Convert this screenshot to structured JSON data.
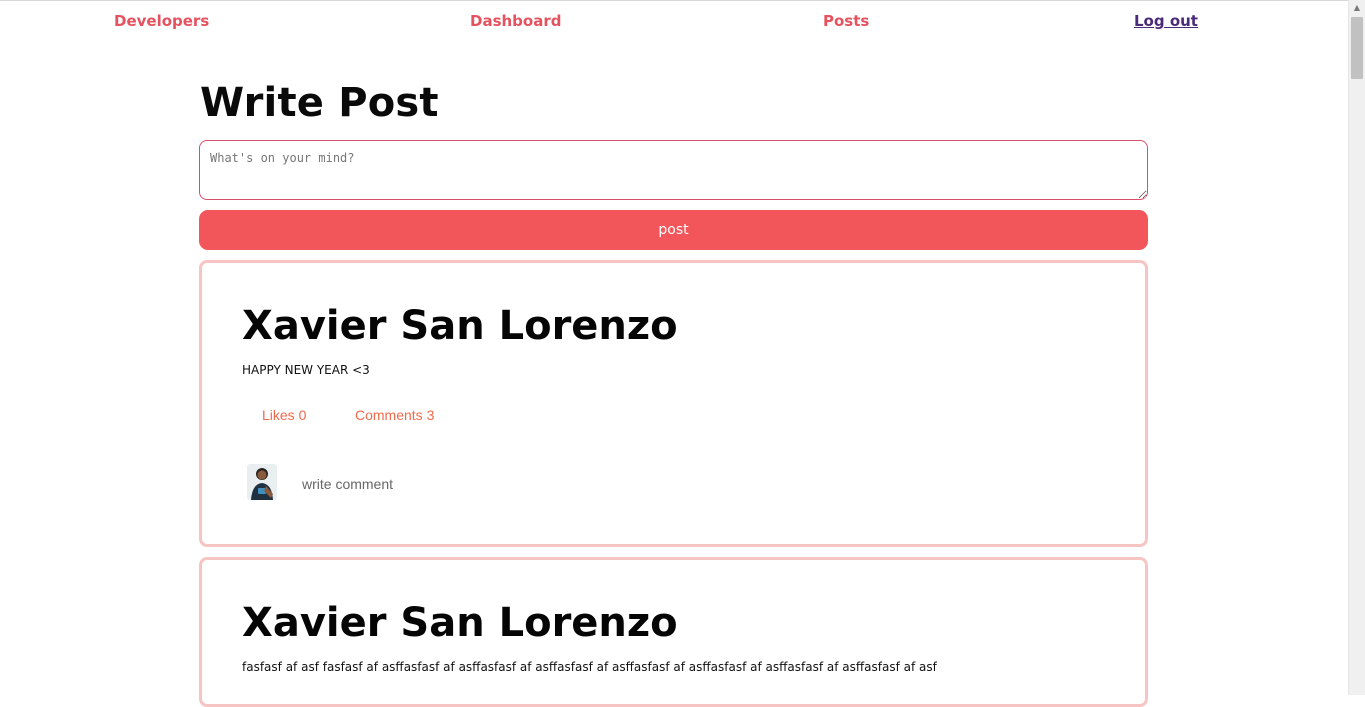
{
  "nav": {
    "developers": "Developers",
    "dashboard": "Dashboard",
    "posts": "Posts",
    "logout": "Log out"
  },
  "page": {
    "title": "Write Post"
  },
  "compose": {
    "placeholder": "What's on your mind?",
    "value": "",
    "submit_label": "post"
  },
  "posts": [
    {
      "author": "Xavier San Lorenzo",
      "text": "HAPPY NEW YEAR <3",
      "likes_label": "Likes 0",
      "comments_label": "Comments 3",
      "comment_placeholder": "write comment",
      "avatar_icon": "user-photo"
    },
    {
      "author": "Xavier San Lorenzo",
      "text": "fasfasf af asf fasfasf af asffasfasf af asffasfasf af asffasfasf af asffasfasf af asffasfasf af asffasfasf af asffasfasf af asf"
    }
  ],
  "colors": {
    "accent": "#f2565a",
    "nav_link": "#e4535f",
    "card_border": "#f7c4c4",
    "action_text": "#f06a4c"
  }
}
